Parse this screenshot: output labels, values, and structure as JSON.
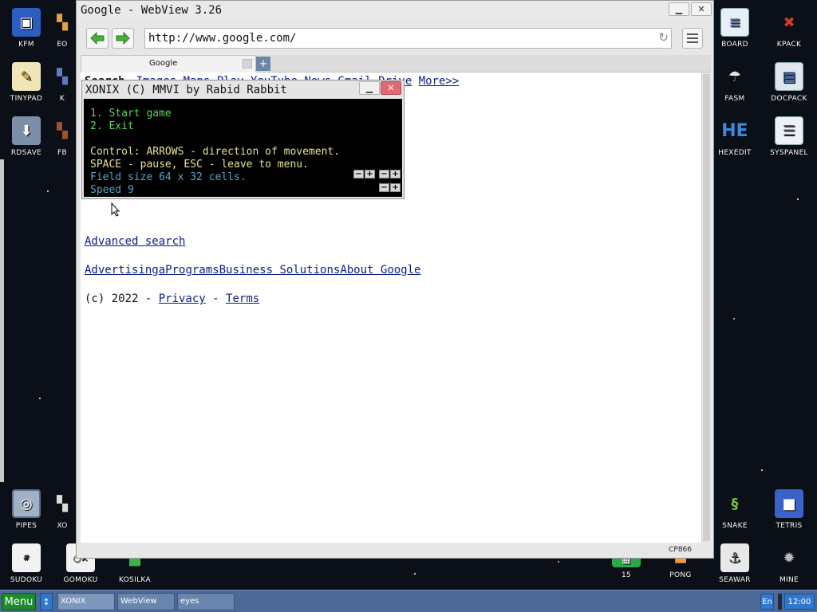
{
  "desktop": {
    "left_icons": [
      {
        "label": "KFM",
        "icon": "floppy-icon"
      },
      {
        "label": "TINYPAD",
        "icon": "notepad-icon"
      },
      {
        "label": "RDSAVE",
        "icon": "ramdisk-save-icon"
      },
      {
        "label": "PIPES",
        "icon": "pipes-game-icon"
      },
      {
        "label": "SUDOKU",
        "icon": "sudoku-icon"
      },
      {
        "label": "GOMOKU",
        "icon": "gomoku-icon"
      },
      {
        "label": "KOSILKA",
        "icon": "lawnmower-icon"
      }
    ],
    "partial_labels": {
      "eo": "EO",
      "k": "K",
      "fb": "FB",
      "xo": "XO"
    },
    "right_icons": [
      {
        "label": "BOARD",
        "icon": "board-icon"
      },
      {
        "label": "KPACK",
        "icon": "kpack-icon"
      },
      {
        "label": "FASM",
        "icon": "fasm-icon"
      },
      {
        "label": "DOCPACK",
        "icon": "docpack-icon"
      },
      {
        "label": "HEXEDIT",
        "icon": "hexedit-icon",
        "glyph_text": "HE"
      },
      {
        "label": "SYSPANEL",
        "icon": "syspanel-icon"
      },
      {
        "label": "SNAKE",
        "icon": "snake-icon"
      },
      {
        "label": "TETRIS",
        "icon": "tetris-icon"
      },
      {
        "label": "15",
        "icon": "fifteen-puzzle-icon"
      },
      {
        "label": "PONG",
        "icon": "pong-icon"
      },
      {
        "label": "SEAWAR",
        "icon": "seawar-icon"
      },
      {
        "label": "MINE",
        "icon": "mine-icon"
      }
    ]
  },
  "webview": {
    "title": "Google - WebView 3.26",
    "url": "http://www.google.com/",
    "tab_label": "Google",
    "nav_links": [
      "Search",
      "Images",
      "Maps",
      "Play",
      "YouTube",
      "News",
      "Gmail",
      "Drive",
      "More>>"
    ],
    "advanced_search": "Advanced search",
    "footer_links": [
      "Advertising",
      "a",
      "Programs",
      "Business Solutions",
      "About Google"
    ],
    "copyright_prefix": "(c) 2022 - ",
    "privacy": "Privacy",
    "dash": " - ",
    "terms": "Terms",
    "encoding": "CP866"
  },
  "xonix": {
    "title": "XONIX (C) MMVI by Rabid Rabbit",
    "menu": [
      "1. Start game",
      "2. Exit"
    ],
    "control_line": "Control: ARROWS - direction of movement.",
    "space_line": "SPACE - pause, ESC - leave to menu.",
    "field_size": "Field size 64 x 32 cells.",
    "speed": "Speed 9"
  },
  "taskbar": {
    "menu_label": "Menu",
    "tasks": [
      "XONIX",
      "WebView",
      "eyes"
    ],
    "lang": "En",
    "clock": "12:00"
  },
  "colors": {
    "taskbar": "#4d6a96",
    "menu_button": "#1f8a2c",
    "close_button": "#e06a74",
    "link": "#0b1c8c"
  }
}
